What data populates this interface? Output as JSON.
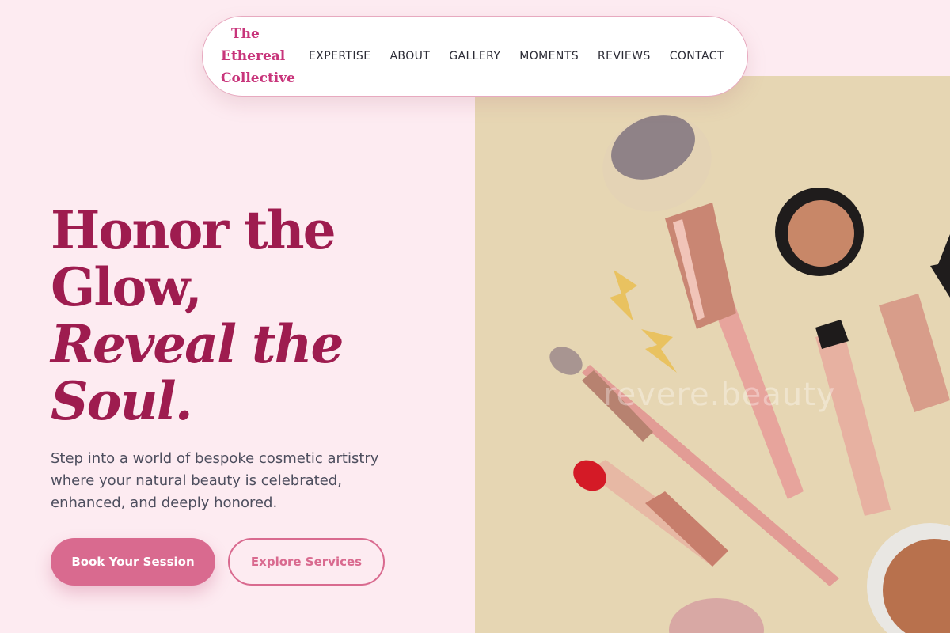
{
  "brand": {
    "line1": "The",
    "line2": "Ethereal",
    "line3": "Collective"
  },
  "nav": {
    "items": [
      {
        "label": "EXPERTISE"
      },
      {
        "label": "ABOUT"
      },
      {
        "label": "GALLERY"
      },
      {
        "label": "MOMENTS"
      },
      {
        "label": "REVIEWS"
      },
      {
        "label": "CONTACT"
      }
    ]
  },
  "hero": {
    "headline_line1": "Honor the",
    "headline_line2": "Glow,",
    "headline_line3": "Reveal the",
    "headline_line4": "Soul.",
    "lede": "Step into a world of bespoke cosmetic artistry where your natural beauty is celebrated, enhanced, and deeply honored.",
    "primary_button": "Book Your Session",
    "secondary_button": "Explore Services",
    "image_watermark": "revere.beauty"
  },
  "colors": {
    "background": "#fdebf1",
    "accent": "#d96a8f",
    "headline": "#9e1c4f",
    "brand": "#c8357b",
    "image_backdrop": "#e6d6b3"
  },
  "icons": [
    "makeup-brush-icon",
    "lipstick-icon",
    "mascara-icon",
    "compact-icon"
  ]
}
